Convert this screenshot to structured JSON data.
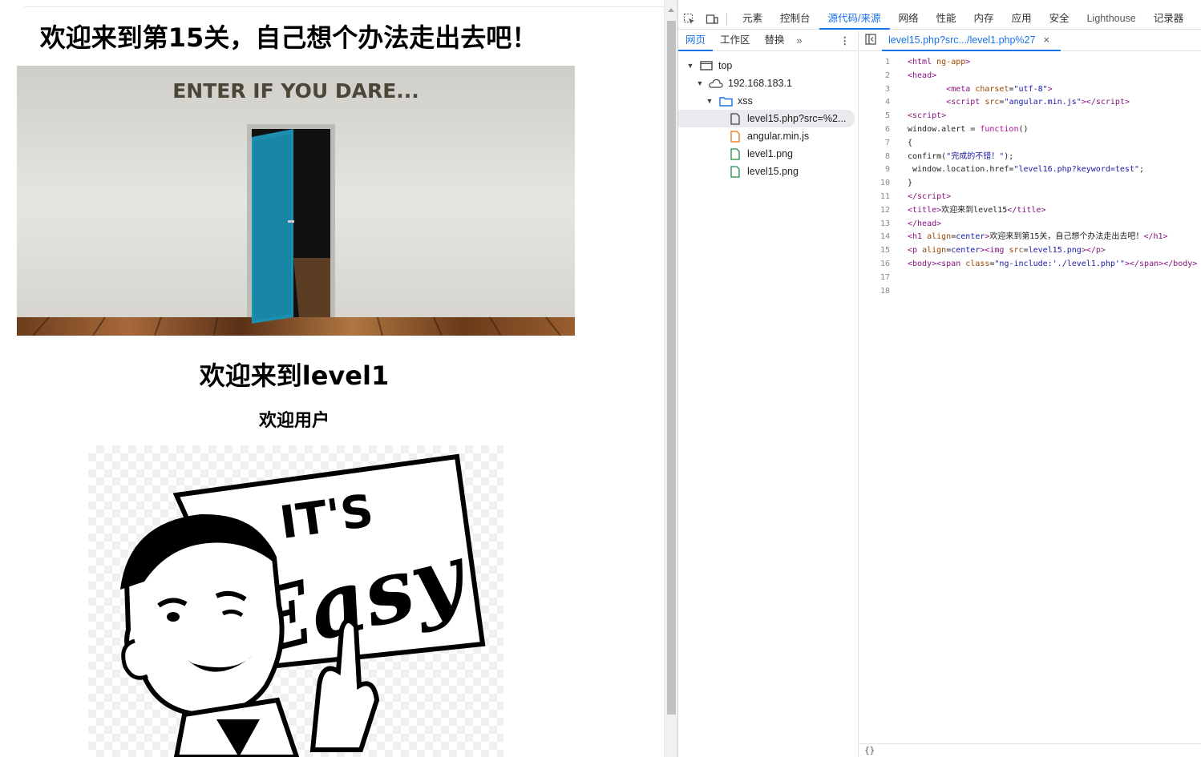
{
  "page": {
    "main_heading": "欢迎来到第15关，自己想个办法走出去吧！",
    "door_image_text": "ENTER IF YOU DARE...",
    "sub_heading": "欢迎来到level1",
    "welcome_text": "欢迎用户",
    "sign_text_1": "IT'S",
    "sign_text_2": "Easy"
  },
  "devtools": {
    "toolbar": {
      "tabs": [
        "元素",
        "控制台",
        "源代码/来源",
        "网络",
        "性能",
        "内存",
        "应用",
        "安全",
        "Lighthouse",
        "记录器"
      ],
      "active_tab": "源代码/来源"
    },
    "navigator": {
      "tabs": [
        "网页",
        "工作区",
        "替换"
      ],
      "more": "»",
      "kebab": "⋮",
      "tree": [
        {
          "label": "top",
          "icon": "frame-icon"
        },
        {
          "label": "192.168.183.1",
          "icon": "cloud-icon"
        },
        {
          "label": "xss",
          "icon": "folder-icon"
        },
        {
          "label": "level15.php?src=%2...",
          "icon": "document-icon"
        },
        {
          "label": "angular.min.js",
          "icon": "script-file-icon"
        },
        {
          "label": "level1.png",
          "icon": "image-file-icon"
        },
        {
          "label": "level15.png",
          "icon": "image-file-icon"
        }
      ]
    },
    "editor": {
      "tab_title": "level15.php?src.../level1.php%27",
      "close": "×",
      "line_numbers": [
        "1",
        "2",
        "3",
        "4",
        "5",
        "6",
        "7",
        "8",
        "9",
        "10",
        "11",
        "12",
        "13",
        "14",
        "15",
        "16",
        "17",
        "18"
      ],
      "status": "{}"
    },
    "colors": {
      "accent": "#1a73e8",
      "tag": "#881280",
      "attr": "#994500",
      "string": "#1a1aa6"
    }
  }
}
